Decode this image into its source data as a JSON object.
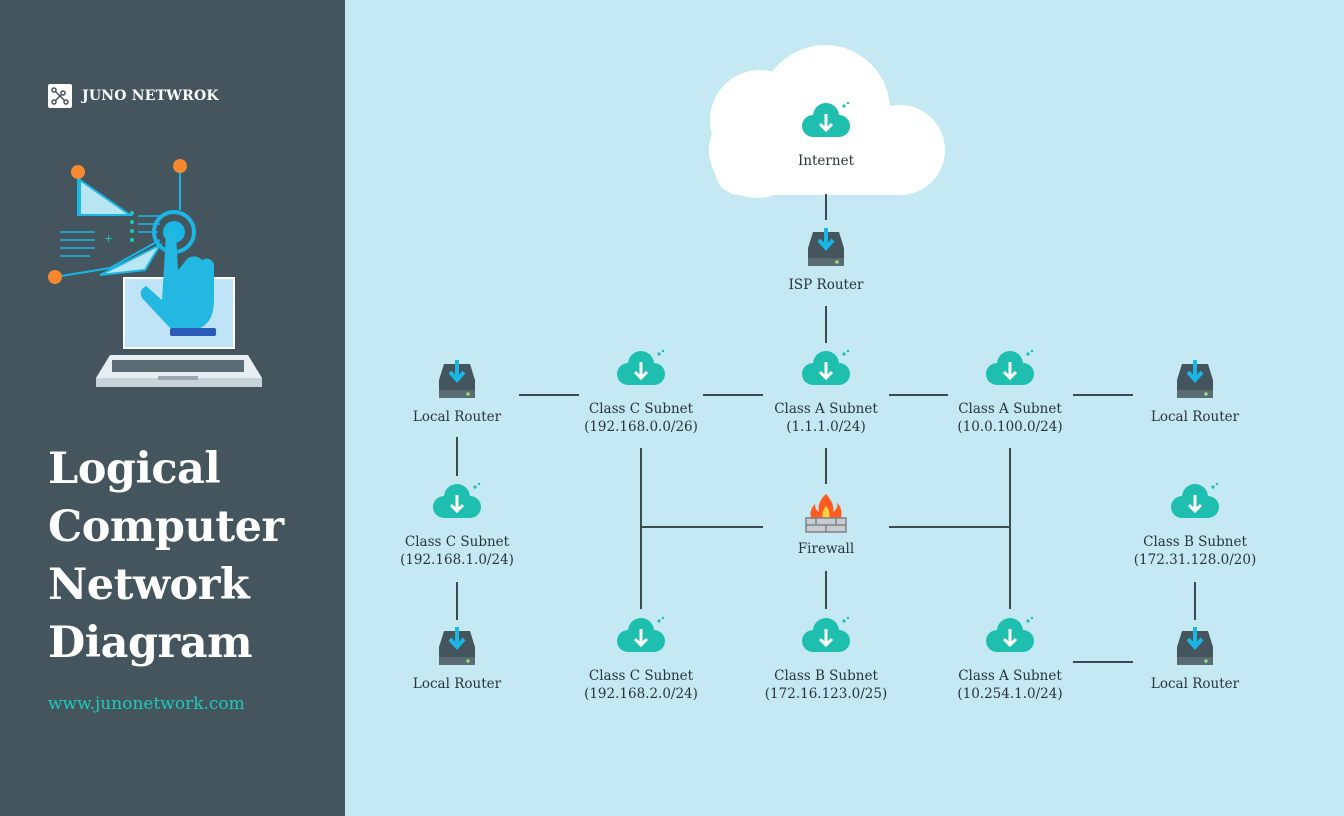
{
  "brand": {
    "name": "JUNO NETWROK",
    "logo_icon": "network-nodes-icon"
  },
  "hero": {
    "title_lines": [
      "Logical",
      "Computer",
      "Network",
      "Diagram"
    ],
    "url": "www.junonetwork.com",
    "illustration_icon": "laptop-touch-icon"
  },
  "colors": {
    "sidebar": "#44555e",
    "canvas": "#c4e9f3",
    "accent": "#1fc9b8",
    "cloud_icon": "#1fbfb0",
    "router_icon": "#44555e",
    "arrow": "#1ab7e6",
    "connector": "#3c4a52",
    "fire": "#ff5a1f"
  },
  "diagram": {
    "internet": {
      "label": "Internet",
      "icon": "cloud-download-icon"
    },
    "isp_router": {
      "label": "ISP Router",
      "icon": "router-icon"
    },
    "firewall": {
      "label": "Firewall",
      "icon": "firewall-icon"
    },
    "class_a_center": {
      "label": "Class A Subnet",
      "sub": "(1.1.1.0/24)",
      "icon": "cloud-download-icon"
    },
    "class_c_top": {
      "label": "Class C Subnet",
      "sub": "(192.168.0.0/26)",
      "icon": "cloud-download-icon"
    },
    "class_a_top_right": {
      "label": "Class A Subnet",
      "sub": "(10.0.100.0/24)",
      "icon": "cloud-download-icon"
    },
    "router_top_left": {
      "label": "Local Router",
      "icon": "router-icon"
    },
    "router_top_right": {
      "label": "Local Router",
      "icon": "router-icon"
    },
    "class_c_left": {
      "label": "Class C Subnet",
      "sub": "(192.168.1.0/24)",
      "icon": "cloud-download-icon"
    },
    "class_b_right": {
      "label": "Class B Subnet",
      "sub": "(172.31.128.0/20)",
      "icon": "cloud-download-icon"
    },
    "router_bottom_left": {
      "label": "Local Router",
      "icon": "router-icon"
    },
    "class_c_bottom": {
      "label": "Class C Subnet",
      "sub": "(192.168.2.0/24)",
      "icon": "cloud-download-icon"
    },
    "class_b_bottom": {
      "label": "Class B Subnet",
      "sub": "(172.16.123.0/25)",
      "icon": "cloud-download-icon"
    },
    "class_a_bottom": {
      "label": "Class A Subnet",
      "sub": "(10.254.1.0/24)",
      "icon": "cloud-download-icon"
    },
    "router_bottom_right": {
      "label": "Local Router",
      "icon": "router-icon"
    }
  }
}
